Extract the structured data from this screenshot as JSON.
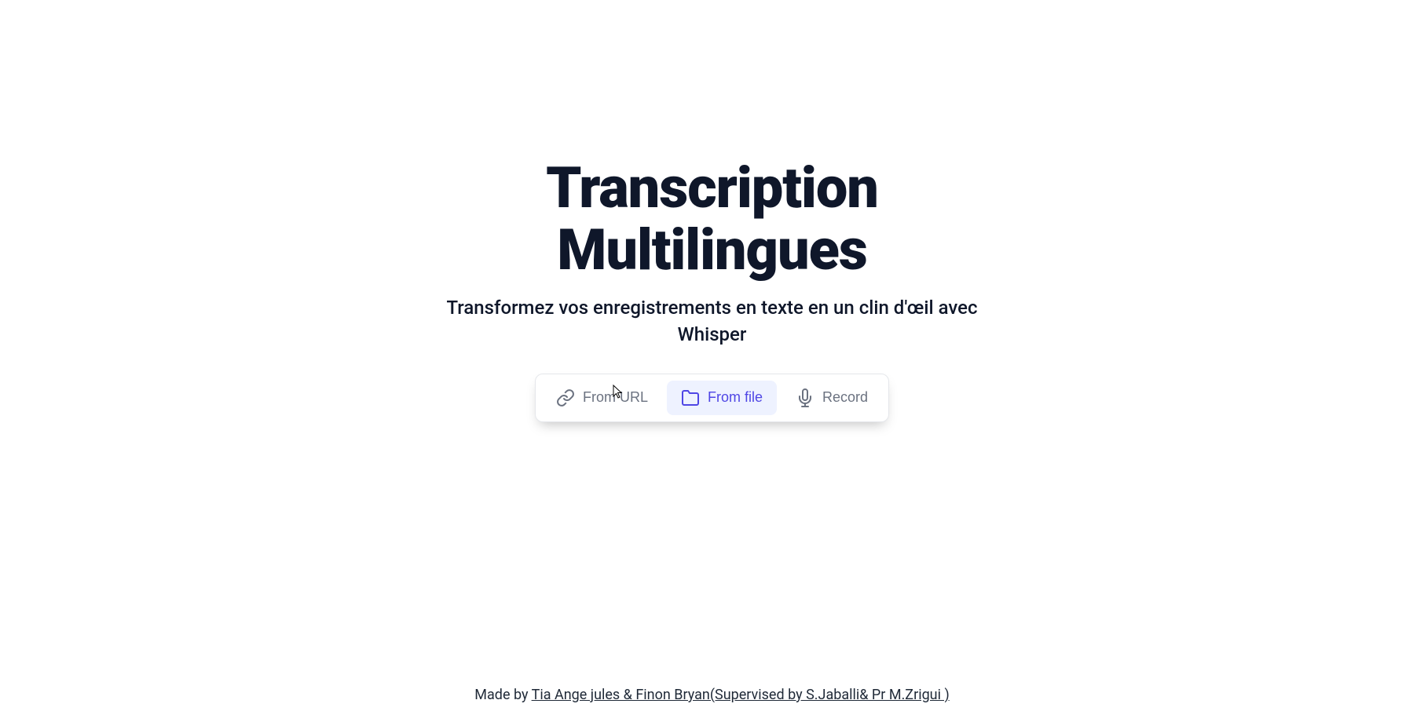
{
  "header": {
    "title_line1": "Transcription",
    "title_line2": "Multilingues",
    "subtitle": "Transformez vos enregistrements en texte en un clin d'œil avec Whisper"
  },
  "tabs": {
    "from_url": {
      "label": "From URL",
      "active": false
    },
    "from_file": {
      "label": "From file",
      "active": true
    },
    "record": {
      "label": "Record",
      "active": false
    }
  },
  "footer": {
    "prefix": "Made by ",
    "link_text": "Tia Ange jules & Finon Bryan(Supervised by S.Jaballi& Pr M.Zrigui )"
  }
}
